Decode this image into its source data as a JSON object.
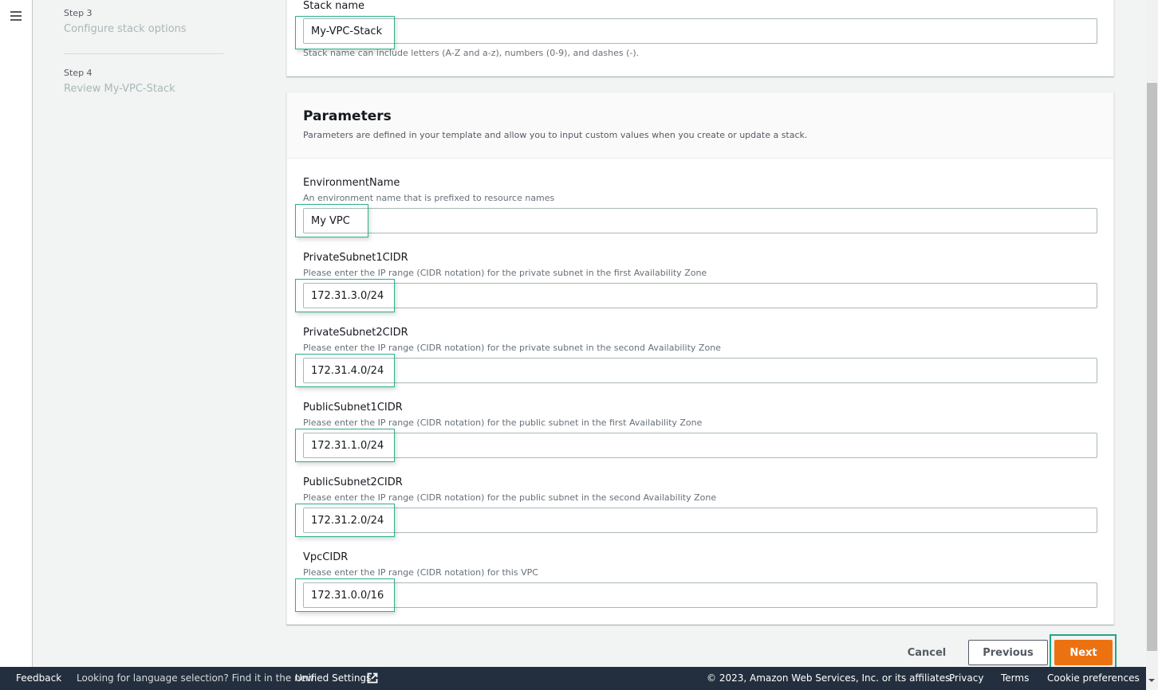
{
  "sidebar": {
    "steps": [
      {
        "label": "Step 3",
        "title": "Configure stack options"
      },
      {
        "label": "Step 4",
        "title": "Review My-VPC-Stack"
      }
    ]
  },
  "stack": {
    "label": "Stack name",
    "value": "My-VPC-Stack",
    "hint": "Stack name can include letters (A-Z and a-z), numbers (0-9), and dashes (-)."
  },
  "parameters": {
    "title": "Parameters",
    "description": "Parameters are defined in your template and allow you to input custom values when you create or update a stack.",
    "fields": [
      {
        "name": "EnvironmentName",
        "description": "An environment name that is prefixed to resource names",
        "value": "My VPC"
      },
      {
        "name": "PrivateSubnet1CIDR",
        "description": "Please enter the IP range (CIDR notation) for the private subnet in the first Availability Zone",
        "value": "172.31.3.0/24"
      },
      {
        "name": "PrivateSubnet2CIDR",
        "description": "Please enter the IP range (CIDR notation) for the private subnet in the second Availability Zone",
        "value": "172.31.4.0/24"
      },
      {
        "name": "PublicSubnet1CIDR",
        "description": "Please enter the IP range (CIDR notation) for the public subnet in the first Availability Zone",
        "value": "172.31.1.0/24"
      },
      {
        "name": "PublicSubnet2CIDR",
        "description": "Please enter the IP range (CIDR notation) for the public subnet in the second Availability Zone",
        "value": "172.31.2.0/24"
      },
      {
        "name": "VpcCIDR",
        "description": "Please enter the IP range (CIDR notation) for this VPC",
        "value": "172.31.0.0/16"
      }
    ]
  },
  "actions": {
    "cancel": "Cancel",
    "previous": "Previous",
    "next": "Next"
  },
  "footer": {
    "feedback": "Feedback",
    "language_prompt": "Looking for language selection? Find it in the new",
    "unified_settings": "Unified Settings",
    "copyright": "© 2023, Amazon Web Services, Inc. or its affiliates.",
    "privacy": "Privacy",
    "terms": "Terms",
    "cookie": "Cookie preferences"
  },
  "colors": {
    "primary_button": "#ec7211",
    "highlight_box": "#2bb08a",
    "footer_bg": "#232f3e"
  }
}
